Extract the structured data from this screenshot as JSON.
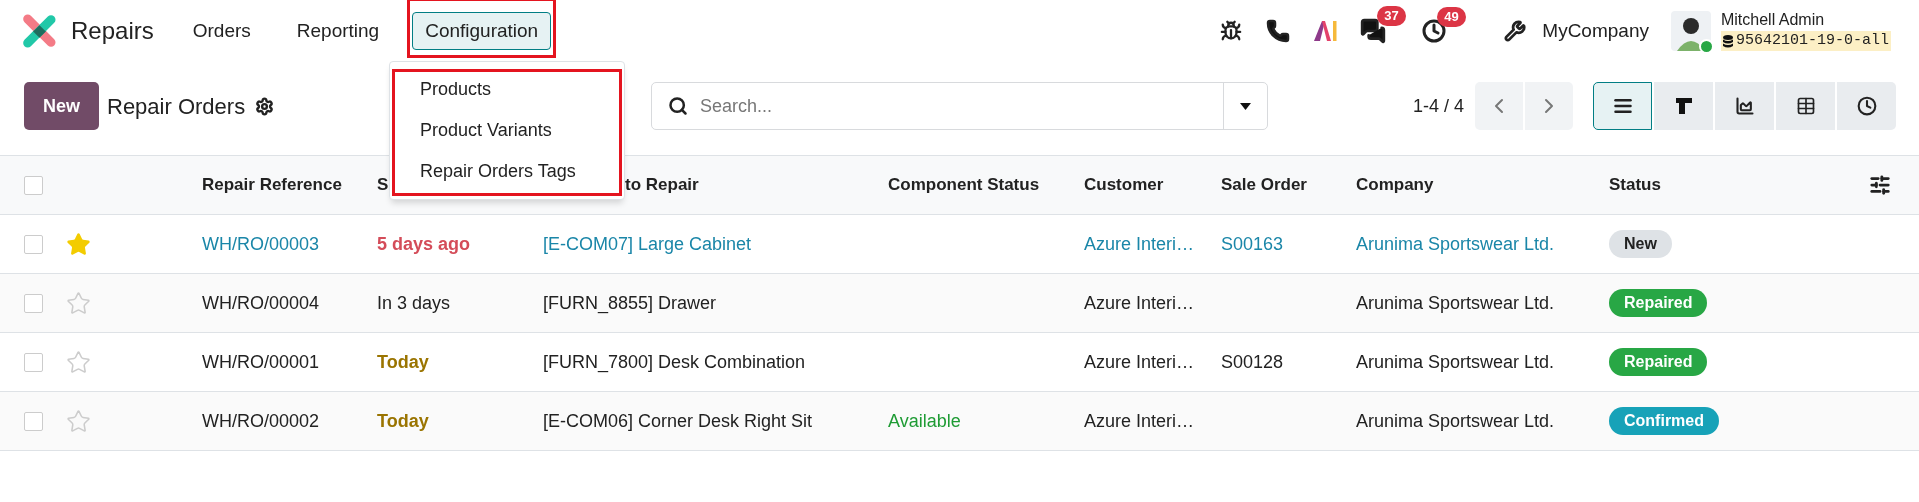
{
  "navbar": {
    "app_name": "Repairs",
    "menus": [
      {
        "label": "Orders",
        "selected": false
      },
      {
        "label": "Reporting",
        "selected": false
      },
      {
        "label": "Configuration",
        "selected": true
      }
    ],
    "dropdown": [
      "Products",
      "Product Variants",
      "Repair Orders Tags"
    ],
    "systray": {
      "messages_count": "37",
      "activities_count": "49",
      "company": "MyCompany",
      "user": "Mitchell Admin",
      "database": "95642101-19-0-all",
      "online": true
    }
  },
  "control_panel": {
    "new_button": "New",
    "title": "Repair Orders",
    "search": {
      "placeholder": "Search..."
    },
    "pager": "1-4 / 4",
    "views": [
      {
        "kind": "list",
        "selected": true
      },
      {
        "kind": "kanban",
        "selected": false
      },
      {
        "kind": "graph",
        "selected": false
      },
      {
        "kind": "pivot",
        "selected": false
      },
      {
        "kind": "activity",
        "selected": false
      }
    ]
  },
  "table": {
    "select_all_checked": false,
    "columns": [
      "Repair Reference",
      "S",
      "to Repair",
      "Component Status",
      "Customer",
      "Sale Order",
      "Company",
      "Status"
    ],
    "rows": [
      {
        "checked": false,
        "starred": true,
        "highlighted": true,
        "reference": "WH/RO/00003",
        "scheduled": {
          "text": "5 days ago",
          "kind": "late"
        },
        "product": "[E-COM07] Large Cabinet",
        "customer": "Azure Interi…",
        "sale_order": "S00163",
        "company": "Arunima Sportswear Ltd.",
        "status": {
          "label": "New",
          "kind": "new"
        }
      },
      {
        "checked": false,
        "starred": false,
        "highlighted": false,
        "reference": "WH/RO/00004",
        "scheduled": {
          "text": "In 3 days",
          "kind": "future"
        },
        "product": "[FURN_8855] Drawer",
        "customer": "Azure Interi…",
        "company": "Arunima Sportswear Ltd.",
        "status": {
          "label": "Repaired",
          "kind": "done"
        }
      },
      {
        "checked": false,
        "starred": false,
        "highlighted": false,
        "reference": "WH/RO/00001",
        "scheduled": {
          "text": "Today",
          "kind": "today"
        },
        "product": "[FURN_7800] Desk Combination",
        "customer": "Azure Interi…",
        "sale_order": "S00128",
        "company": "Arunima Sportswear Ltd.",
        "status": {
          "label": "Repaired",
          "kind": "done"
        }
      },
      {
        "checked": false,
        "starred": false,
        "highlighted": false,
        "reference": "WH/RO/00002",
        "scheduled": {
          "text": "Today",
          "kind": "today"
        },
        "product": "[E-COM06] Corner Desk Right Sit",
        "component_status": "Available",
        "customer": "Azure Interi…",
        "company": "Arunima Sportswear Ltd.",
        "status": {
          "label": "Confirmed",
          "kind": "confirmed"
        }
      }
    ]
  }
}
